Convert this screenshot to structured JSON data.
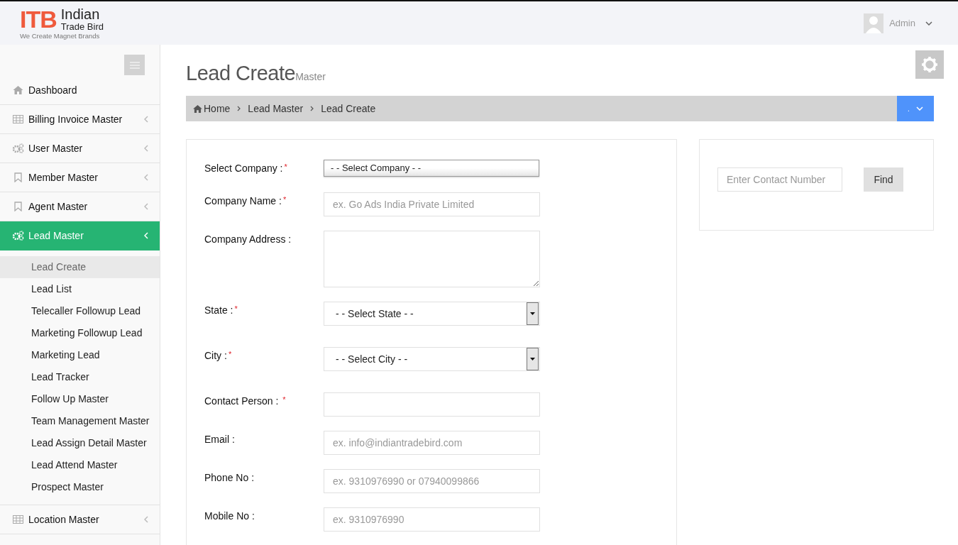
{
  "header": {
    "logo_mark": "ITB",
    "logo_name_1": "Indian",
    "logo_name_2": "Trade Bird",
    "logo_tagline": "We Create Magnet Brands",
    "user": "Admin"
  },
  "sidebar": {
    "items": [
      {
        "label": "Dashboard",
        "kind": "home",
        "has_caret": false,
        "selected": false
      },
      {
        "label": "Billing Invoice Master",
        "kind": "table",
        "has_caret": true,
        "selected": false
      },
      {
        "label": "User Master",
        "kind": "gears",
        "has_caret": true,
        "selected": false
      },
      {
        "label": "Member Master",
        "kind": "bookmark",
        "has_caret": true,
        "selected": false
      },
      {
        "label": "Agent Master",
        "kind": "bookmark",
        "has_caret": true,
        "selected": false
      },
      {
        "label": "Lead Master",
        "kind": "gears",
        "has_caret": true,
        "selected": true,
        "children": [
          {
            "label": "Lead Create",
            "selected": true
          },
          {
            "label": "Lead List",
            "selected": false
          },
          {
            "label": "Telecaller Followup Lead",
            "selected": false
          },
          {
            "label": "Marketing Followup Lead",
            "selected": false
          },
          {
            "label": "Marketing Lead",
            "selected": false
          },
          {
            "label": "Lead Tracker",
            "selected": false
          },
          {
            "label": "Follow Up Master",
            "selected": false
          },
          {
            "label": "Team Management Master",
            "selected": false
          },
          {
            "label": "Lead Assign Detail Master",
            "selected": false
          },
          {
            "label": "Lead Attend Master",
            "selected": false
          },
          {
            "label": "Prospect Master",
            "selected": false
          }
        ]
      },
      {
        "label": "Location Master",
        "kind": "table",
        "has_caret": true,
        "selected": false
      }
    ]
  },
  "page": {
    "title": "Lead Create",
    "subtitle": "Master"
  },
  "breadcrumb": {
    "items": [
      "Home",
      "Lead Master",
      "Lead Create"
    ],
    "action_label": "."
  },
  "form": {
    "fields": [
      {
        "label": "Select Company :",
        "required_mark": "*",
        "kind": "combo",
        "value": "- - Select Company - -"
      },
      {
        "label": "Company Name :",
        "required_mark": "*",
        "kind": "text",
        "placeholder": "ex. Go Ads India Private Limited"
      },
      {
        "label": "Company Address :",
        "kind": "textarea"
      },
      {
        "label": "State :",
        "required_mark": "*",
        "kind": "select",
        "value": "- - Select State - -"
      },
      {
        "label": "City :",
        "required_mark": "*",
        "kind": "select",
        "value": "- - Select City - -"
      },
      {
        "label": "Contact Person : ",
        "required_mark": "*",
        "kind": "text"
      },
      {
        "label": "Email :",
        "kind": "text",
        "placeholder": "ex. info@indiantradebird.com"
      },
      {
        "label": "Phone No :",
        "kind": "text",
        "placeholder": "ex. 9310976990 or 07940099866"
      },
      {
        "label": "Mobile No :",
        "kind": "text",
        "placeholder": "ex. 9310976990"
      }
    ]
  },
  "search": {
    "placeholder": "Enter Contact Number",
    "button": "Find"
  }
}
